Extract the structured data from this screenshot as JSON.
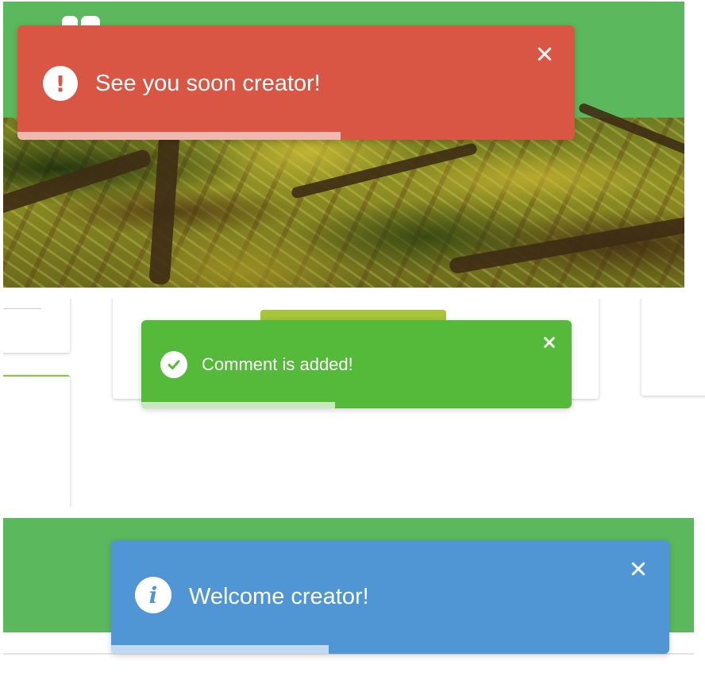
{
  "panels": {
    "logout": {
      "header_color": "#5cb85c",
      "hero_image": "tree-foliage-photo"
    },
    "comment": {
      "accent_color": "#8cc63f",
      "button_peek_color": "#a8c43a"
    },
    "login": {
      "header_color": "#5cb85c"
    }
  },
  "toasts": {
    "error": {
      "message": "See you soon creator!",
      "icon": "exclamation-icon",
      "icon_glyph": "!",
      "close_icon": "close-icon",
      "background": "#d95645",
      "progress_color": "#f1b8b0",
      "progress_fraction": 0.58
    },
    "success": {
      "message": "Comment is added!",
      "icon": "checkmark-icon",
      "close_icon": "close-icon",
      "background": "#55b939",
      "progress_color": "#c8e8bd",
      "progress_fraction": 0.45
    },
    "info": {
      "message": "Welcome creator!",
      "icon": "info-icon",
      "icon_glyph": "i",
      "close_icon": "close-icon",
      "background": "#5095d4",
      "progress_color": "#c2daf1",
      "progress_fraction": 0.39
    }
  }
}
